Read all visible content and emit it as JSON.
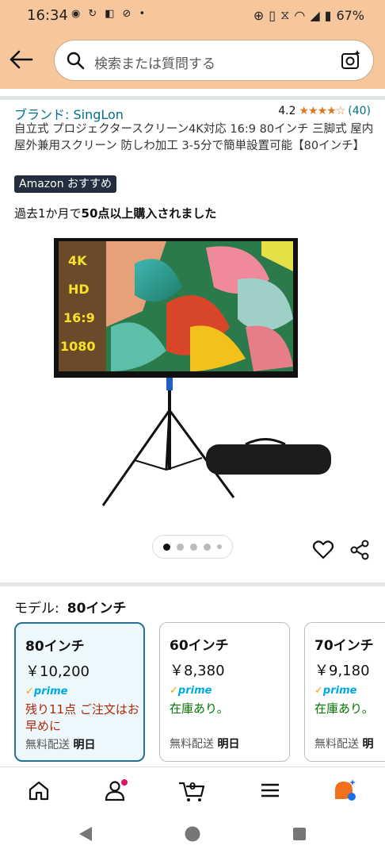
{
  "status_bar": {
    "time": "16:34",
    "battery": "67%"
  },
  "search": {
    "placeholder": "検索または質問する"
  },
  "product": {
    "brand": "ブランド: SingLon",
    "rating": "4.2",
    "stars": "★★★★☆",
    "review_count": "(40)",
    "title": "自立式 プロジェクタースクリーン4K対応 16:9 80インチ 三脚式 屋内屋外兼用スクリーン 防しわ加工 3-5分で簡単設置可能【80インチ】",
    "badge": "Amazon おすすめ",
    "bought_prefix": "過去1か月で",
    "bought_bold": "50点以上購入されました",
    "image_labels": [
      "4K",
      "HD",
      "16:9",
      "1080"
    ]
  },
  "gallery": {
    "dots": 5,
    "active_index": 0
  },
  "model": {
    "label": "モデル:",
    "value": "80インチ"
  },
  "variants": [
    {
      "name": "80インチ",
      "price": "￥10,200",
      "prime": "prime",
      "stock": "残り11点 ご注文はお早めに",
      "ship_prefix": "無料配送 ",
      "ship_bold": "明日"
    },
    {
      "name": "60インチ",
      "price": "￥8,380",
      "prime": "prime",
      "stock": "在庫あり。",
      "ship_prefix": "無料配送 ",
      "ship_bold": "明日"
    },
    {
      "name": "70インチ",
      "price": "￥9,180",
      "prime": "prime",
      "stock": "在庫あり。",
      "ship_prefix": "無料配送 ",
      "ship_bold": "明"
    }
  ],
  "bottom_nav": {
    "cart_count": "0"
  },
  "colors": {
    "header": "#f6c79d",
    "link": "#007185",
    "star": "#de7921",
    "prime": "#00a8e1",
    "selected_border": "#2a6f97"
  }
}
